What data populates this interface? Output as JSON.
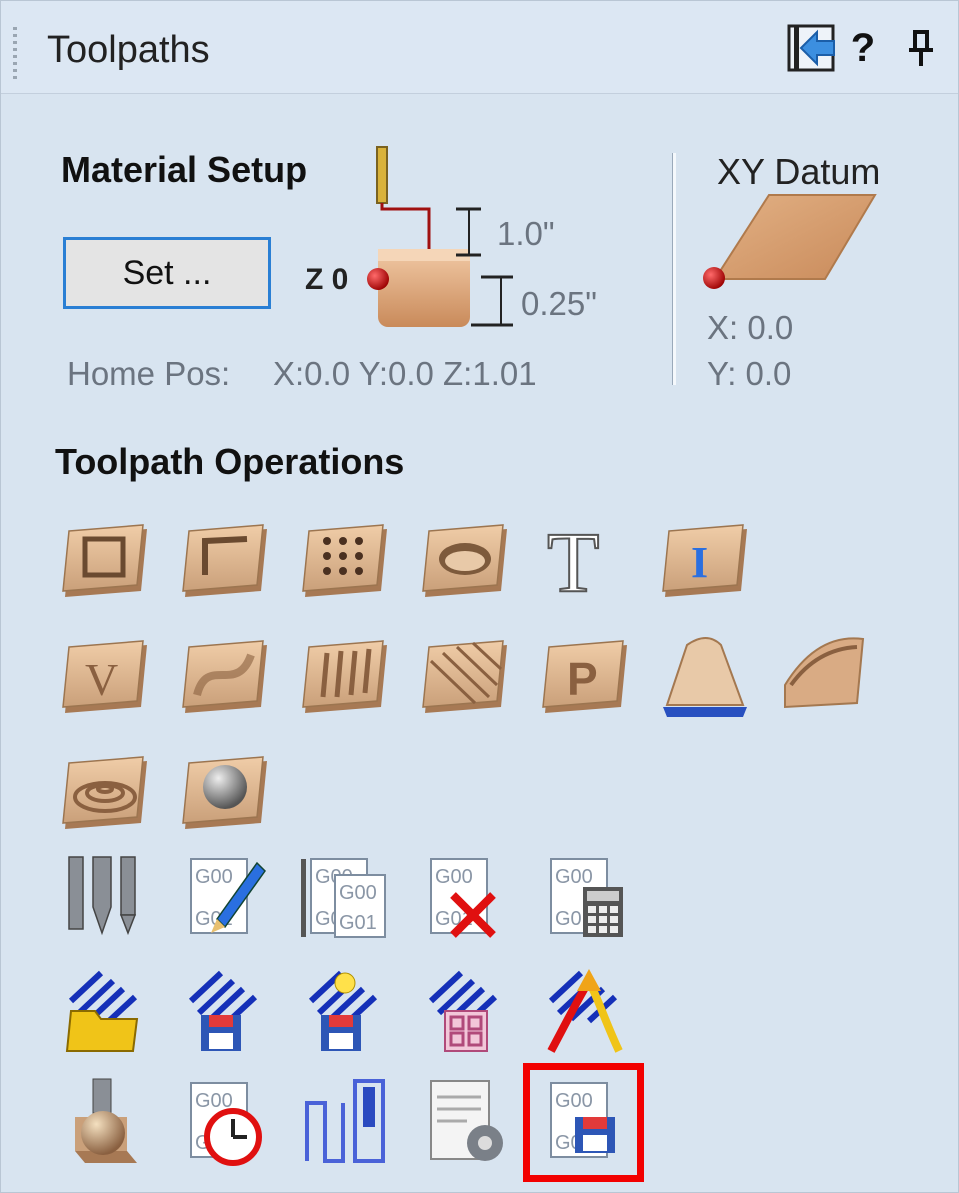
{
  "panel": {
    "title": "Toolpaths",
    "help_label": "?"
  },
  "material_setup": {
    "heading": "Material Setup",
    "set_button": "Set ...",
    "z_label": "Z 0",
    "clearance": "1.0\"",
    "thickness": "0.25\"",
    "home_pos_label": "Home Pos:",
    "home_pos_value": "X:0.0 Y:0.0 Z:1.01"
  },
  "xy_datum": {
    "heading": "XY Datum",
    "x": "X: 0.0",
    "y": "Y: 0.0"
  },
  "operations": {
    "heading": "Toolpath Operations",
    "tools": [
      {
        "icon": "profile-toolpath-icon"
      },
      {
        "icon": "pocket-toolpath-icon"
      },
      {
        "icon": "drilling-toolpath-icon"
      },
      {
        "icon": "quick-engrave-toolpath-icon"
      },
      {
        "icon": "texture-toolpath-icon"
      },
      {
        "icon": "inlay-toolpath-icon"
      },
      {
        "icon": "v-carve-toolpath-icon"
      },
      {
        "icon": "3d-roughing-toolpath-icon"
      },
      {
        "icon": "fluting-toolpath-icon"
      },
      {
        "icon": "3d-finishing-toolpath-icon"
      },
      {
        "icon": "prism-carve-toolpath-icon"
      },
      {
        "icon": "moulding-toolpath-icon"
      },
      {
        "icon": "chamfer-toolpath-icon"
      },
      {
        "icon": "2d-profile-ripple-icon"
      },
      {
        "icon": "3d-sphere-toolpath-icon"
      },
      {
        "icon": "tool-database-icon"
      },
      {
        "icon": "edit-gcode-icon"
      },
      {
        "icon": "merge-toolpaths-icon"
      },
      {
        "icon": "delete-toolpath-icon"
      },
      {
        "icon": "toolpath-calculator-icon"
      },
      {
        "icon": "open-template-icon"
      },
      {
        "icon": "save-template-icon"
      },
      {
        "icon": "template-wizard-icon"
      },
      {
        "icon": "toolpath-tiling-icon"
      },
      {
        "icon": "toolpath-ramp-icon"
      },
      {
        "icon": "preview-toolpath-icon"
      },
      {
        "icon": "estimate-time-icon"
      },
      {
        "icon": "visible-toolpaths-icon"
      },
      {
        "icon": "postprocessor-settings-icon"
      },
      {
        "icon": "save-toolpath-icon"
      }
    ]
  },
  "colors": {
    "panel_bg": "#d8e4f0",
    "highlight": "#f20000",
    "accent": "#2a7fd4"
  }
}
